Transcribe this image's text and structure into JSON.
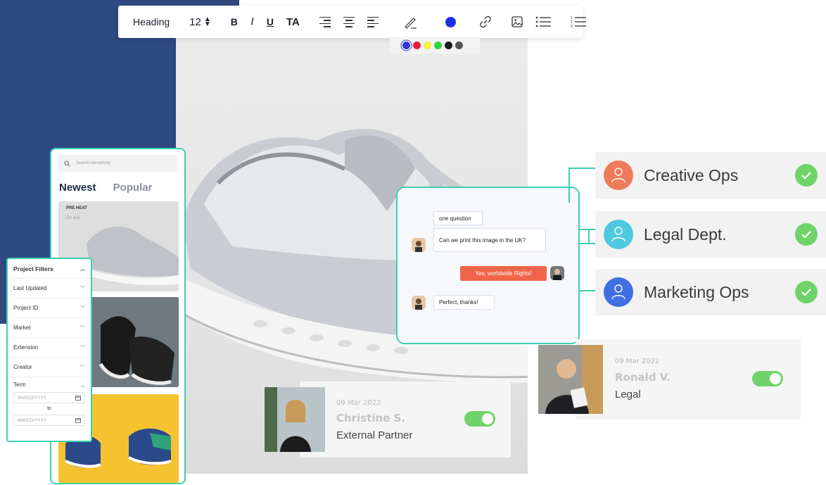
{
  "toolbar": {
    "heading": "Heading",
    "font_size": "12",
    "bold": "B",
    "italic": "I",
    "underline": "U",
    "text_align": "TA",
    "current_color": "#1a2fe8",
    "palette": [
      "#2a3bd6",
      "#ee1c3c",
      "#f6ef3a",
      "#31d43c",
      "#1a1a1a",
      "#555555"
    ]
  },
  "mobile": {
    "search_placeholder": "Search something",
    "tabs": [
      "Newest",
      "Popular"
    ],
    "card_title": "PRE HEAT",
    "card_subtitle": "On ava"
  },
  "filters": {
    "title": "Project Filters",
    "rows": [
      "Last Updated",
      "Project ID",
      "Market",
      "Extension",
      "Creator"
    ],
    "term_label": "Term",
    "date_placeholder": "MM/DD/YYYY",
    "to_label": "to"
  },
  "chat": {
    "messages": [
      {
        "text": "one question"
      },
      {
        "text": "Can we print this image in the UK?"
      },
      {
        "text": "Yes, worldwide Rights!"
      },
      {
        "text": "Perfect, thanks!"
      }
    ]
  },
  "teams": [
    {
      "label": "Creative Ops",
      "color": "#f07b5c"
    },
    {
      "label": "Legal Dept.",
      "color": "#4fc9e0"
    },
    {
      "label": "Marketing Ops",
      "color": "#3f6fe0"
    }
  ],
  "users": [
    {
      "date": "09 Mar 2022",
      "name": "Christine S.",
      "role": "External Partner"
    },
    {
      "date": "09 Mar 2022",
      "name": "Ronald V.",
      "role": "Legal"
    }
  ]
}
